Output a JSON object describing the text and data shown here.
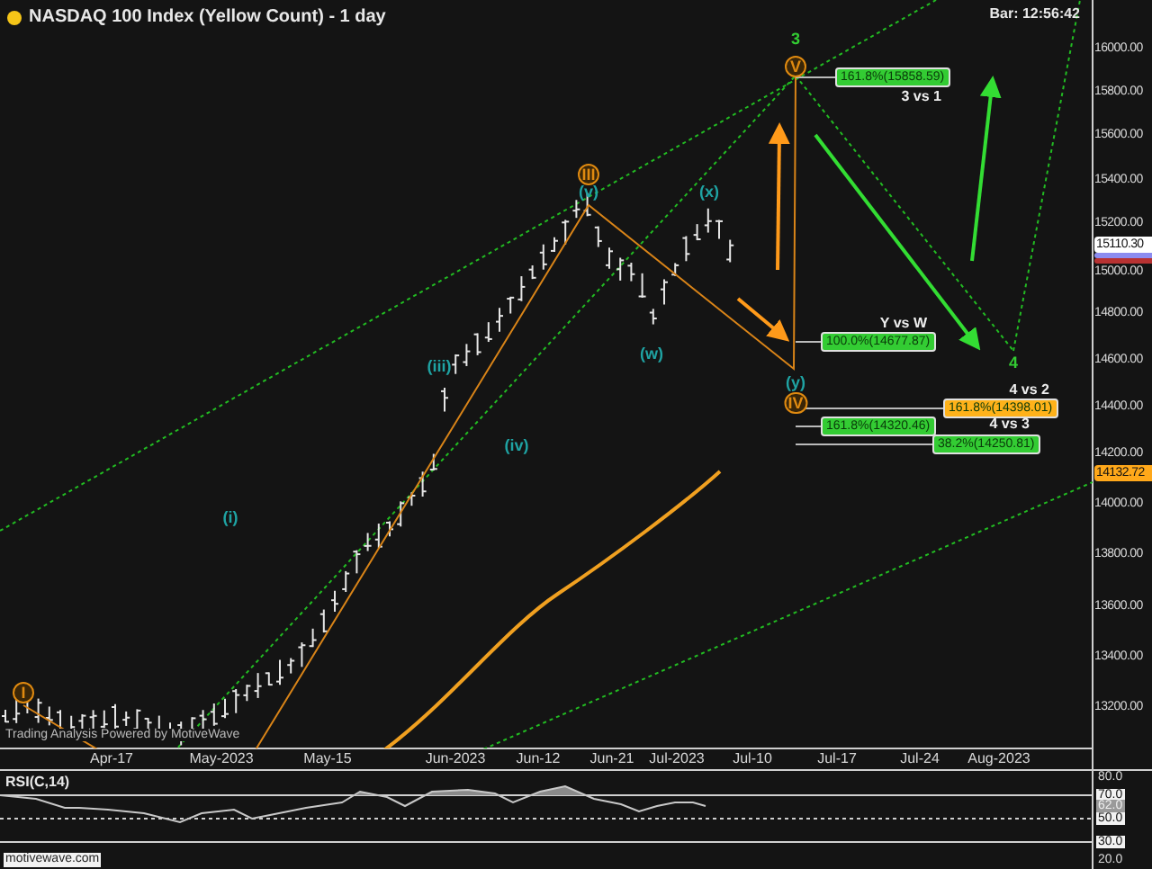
{
  "header": {
    "title": "NASDAQ 100 Index (Yellow Count) - 1 day",
    "bar_timer": "Bar: 12:56:42"
  },
  "wave_labels": [
    {
      "text": "3",
      "kind": "plain",
      "color": "#33cc33"
    },
    {
      "text": "V",
      "kind": "circled",
      "color": "#e08a10"
    },
    {
      "text": "III",
      "kind": "circled",
      "color": "#e08a10"
    },
    {
      "text": "(v)",
      "kind": "plain",
      "color": "#1fa3a3"
    },
    {
      "text": "(x)",
      "kind": "plain",
      "color": "#1fa3a3"
    },
    {
      "text": "(iii)",
      "kind": "plain",
      "color": "#1fa3a3"
    },
    {
      "text": "(w)",
      "kind": "plain",
      "color": "#1fa3a3"
    },
    {
      "text": "4",
      "kind": "plain",
      "color": "#33cc33"
    },
    {
      "text": "(y)",
      "kind": "plain",
      "color": "#1fa3a3"
    },
    {
      "text": "IV",
      "kind": "circled",
      "color": "#e08a10"
    },
    {
      "text": "(iv)",
      "kind": "plain",
      "color": "#1fa3a3"
    },
    {
      "text": "(i)",
      "kind": "plain",
      "color": "#1fa3a3"
    },
    {
      "text": "I",
      "kind": "circled",
      "color": "#e08a10"
    }
  ],
  "fib_targets": [
    {
      "caption": "3 vs 1",
      "value": "161.8%(15858.59)",
      "color": "#33cc33"
    },
    {
      "caption": "Y vs W",
      "value": "100.0%(14677.87)",
      "color": "#33cc33"
    },
    {
      "caption": "4 vs 2",
      "value": "161.8%(14398.01)",
      "color": "#ffb21a"
    },
    {
      "value": "161.8%(14320.46)",
      "color": "#33cc33"
    },
    {
      "caption": "4 vs 3",
      "value": "38.2%(14250.81)",
      "color": "#33cc33"
    }
  ],
  "price_axis": {
    "labels": [
      "16000.00",
      "15800.00",
      "15600.00",
      "15400.00",
      "15200.00",
      "15000.00",
      "14800.00",
      "14600.00",
      "14400.00",
      "14200.00",
      "14000.00",
      "13800.00",
      "13600.00",
      "13400.00",
      "13200.00"
    ],
    "badges": [
      {
        "color": "#8c8cf0"
      },
      {
        "color": "#b83232"
      },
      {
        "text": "15110.30",
        "color": "#ffffff"
      },
      {
        "text": "14132.72",
        "color": "#ffa81a"
      }
    ]
  },
  "credit": "Trading Analysis Powered by MotiveWave",
  "time_axis": {
    "labels": [
      "Apr-17",
      "May-2023",
      "May-15",
      "Jun-2023",
      "Jun-12",
      "Jun-21",
      "Jul-2023",
      "Jul-10",
      "Jul-17",
      "Jul-24",
      "Aug-2023"
    ]
  },
  "rsi": {
    "title": "RSI(C,14)",
    "labels": [
      {
        "text": "80.0",
        "kind": "plain"
      },
      {
        "text": "70.0",
        "kind": "boxed"
      },
      {
        "text": "62.0",
        "kind": "shaded"
      },
      {
        "text": "50.0",
        "kind": "boxed"
      },
      {
        "text": "30.0",
        "kind": "boxed"
      },
      {
        "text": "20.0",
        "kind": "plain"
      }
    ]
  },
  "watermark": "motivewave.com"
}
